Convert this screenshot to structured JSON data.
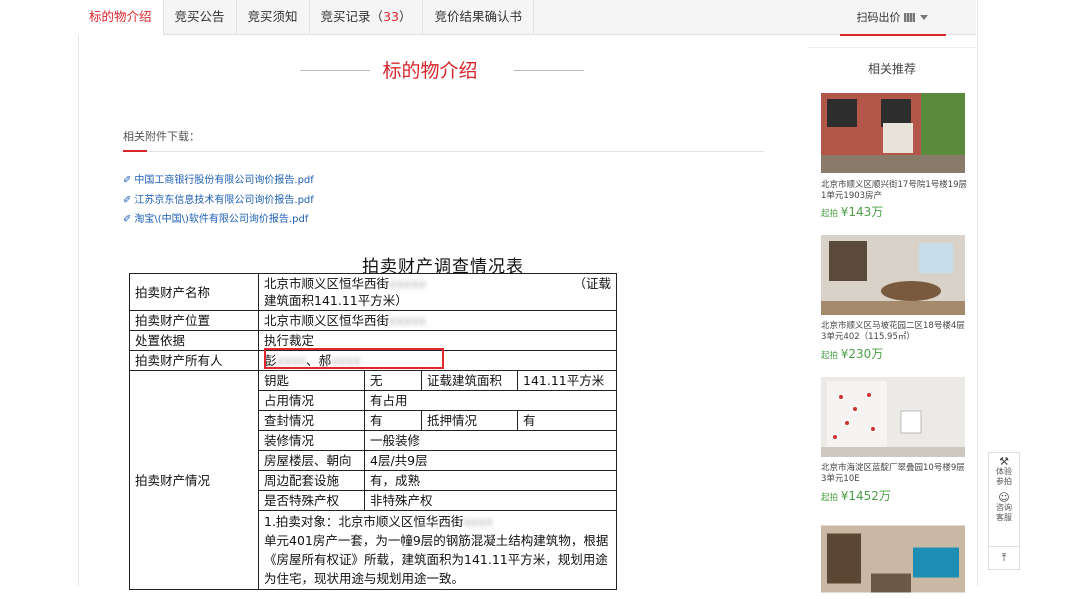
{
  "tabs": [
    {
      "label": "标的物介绍"
    },
    {
      "label": "竞买公告"
    },
    {
      "label": "竞买须知"
    },
    {
      "label": "竞买记录（",
      "count": "33",
      "suffix": "）"
    },
    {
      "label": "竞价结果确认书"
    }
  ],
  "scan": {
    "label": "扫码出价",
    "icon": "qr-icon"
  },
  "section": {
    "title": "标的物介绍"
  },
  "attachments": {
    "label": "相关附件下载：",
    "files": [
      "中国工商银行股份有限公司询价报告.pdf",
      "江苏京东信息技术有限公司询价报告.pdf",
      "淘宝\\(中国\\)软件有限公司询价报告.pdf"
    ]
  },
  "document": {
    "title": "拍卖财产调查情况表",
    "rows": {
      "name_label": "拍卖财产名称",
      "name_value": "北京市顺义区恒华西街",
      "name_value_tail": "（证载",
      "name_value_line2": "建筑面积141.11平方米）",
      "location_label": "拍卖财产位置",
      "location_value": "北京市顺义区恒华西街",
      "basis_label": "处置依据",
      "basis_value": "执行裁定",
      "owner_label": "拍卖财产所有人",
      "owner_value_1": "彭",
      "owner_value_2": "、郝",
      "situation_label": "拍卖财产情况",
      "key_label": "钥匙",
      "key_value": "无",
      "area_label": "证载建筑面积",
      "area_value": "141.11平方米",
      "occupy_label": "占用情况",
      "occupy_value": "有占用",
      "seal_label": "查封情况",
      "seal_value": "有",
      "mortgage_label": "抵押情况",
      "mortgage_value": "有",
      "decor_label": "装修情况",
      "decor_value": "一般装修",
      "floor_label": "房屋楼层、朝向",
      "floor_value": "4层/共9层",
      "facility_label": "周边配套设施",
      "facility_value": "有，成熟",
      "special_label": "是否特殊产权",
      "special_value": "非特殊产权",
      "desc_text": "1.拍卖对象：北京市顺义区恒华西街",
      "desc_text2": "单元401房产一套，为一幢9层的钢筋混凝土结构建筑物，根据《房屋所有权证》所载，建筑面积为141.11平方米，规划用途为住宅，现状用途与规划用途一致。"
    }
  },
  "related": {
    "title": "相关推荐",
    "items": [
      {
        "desc": "北京市顺义区顺兴街17号院1号楼19层1单元1903房产",
        "price_prefix": "起拍",
        "price": "¥143万"
      },
      {
        "desc": "北京市顺义区马坡花园二区18号楼4层3单元402（115.95㎡）",
        "price_prefix": "起拍",
        "price": "¥230万"
      },
      {
        "desc": "北京市海淀区蓝靛厂翠叠园10号楼9层3单元10E",
        "price_prefix": "起拍",
        "price": "¥1452万"
      },
      {
        "desc": "",
        "price_prefix": "",
        "price": ""
      }
    ]
  },
  "side": {
    "experience": "体验参拍",
    "consult": "咨询客服"
  },
  "colors": {
    "accent": "#d9262c",
    "link": "#1e5fb4",
    "price": "#4aa046"
  }
}
